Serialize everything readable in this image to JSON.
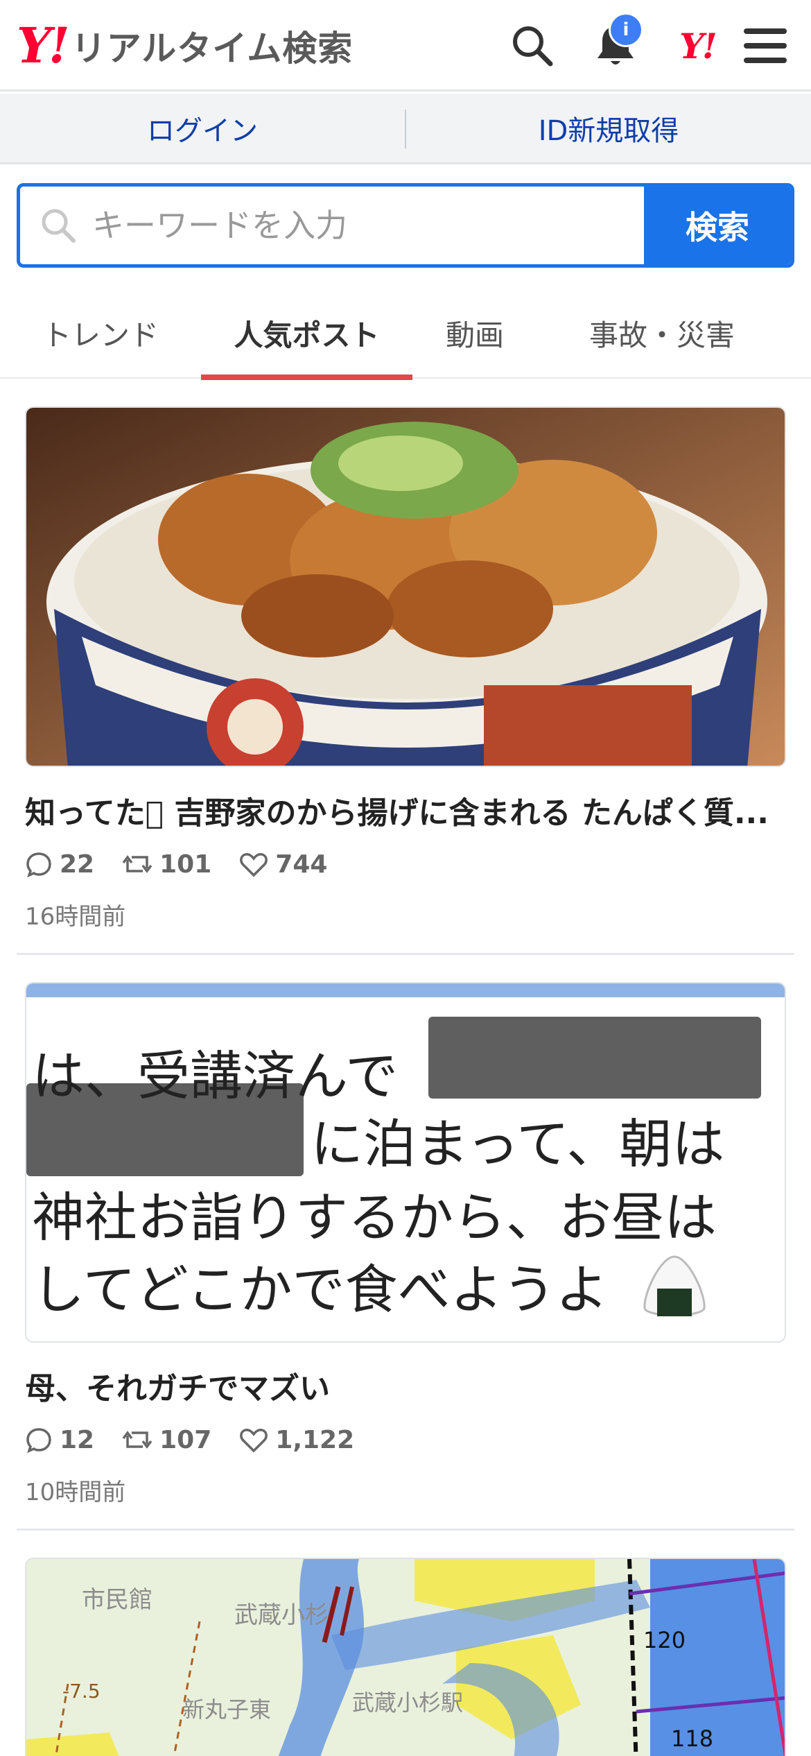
{
  "header": {
    "logo_mark": "Y!",
    "logo_text": "リアルタイム検索",
    "notification_badge": "i",
    "yj_mark": "Y!"
  },
  "login": {
    "login_label": "ログイン",
    "register_label": "ID新規取得"
  },
  "search": {
    "placeholder": "キーワードを入力",
    "button_label": "検索"
  },
  "tabs": [
    {
      "label": "トレンド",
      "active": false
    },
    {
      "label": "人気ポスト",
      "active": true
    },
    {
      "label": "動画",
      "active": false
    },
    {
      "label": "事故・災害",
      "active": false
    }
  ],
  "posts": [
    {
      "title": "知ってた􀀀 吉野家のから揚げに含まれる たんぱく質...",
      "replies": "22",
      "reposts": "101",
      "likes": "744",
      "time": "16時間前"
    },
    {
      "title": "母、それガチでマズい",
      "replies": "12",
      "reposts": "107",
      "likes": "1,122",
      "time": "10時間前",
      "image_text": [
        "は、受講済んで",
        "に泊まって、朝は",
        "神社お詣りするから、お昼は",
        "してどこかで食べようよ"
      ]
    }
  ],
  "map": {
    "labels": [
      "市民館",
      "武蔵小杉",
      "新丸子東",
      "武蔵小杉駅",
      "-7.5",
      "120",
      "118"
    ]
  },
  "colors": {
    "accent": "#1a73e8",
    "brand_red": "#ff0033",
    "tab_underline": "#e0484d",
    "link": "#0f3ea8"
  }
}
